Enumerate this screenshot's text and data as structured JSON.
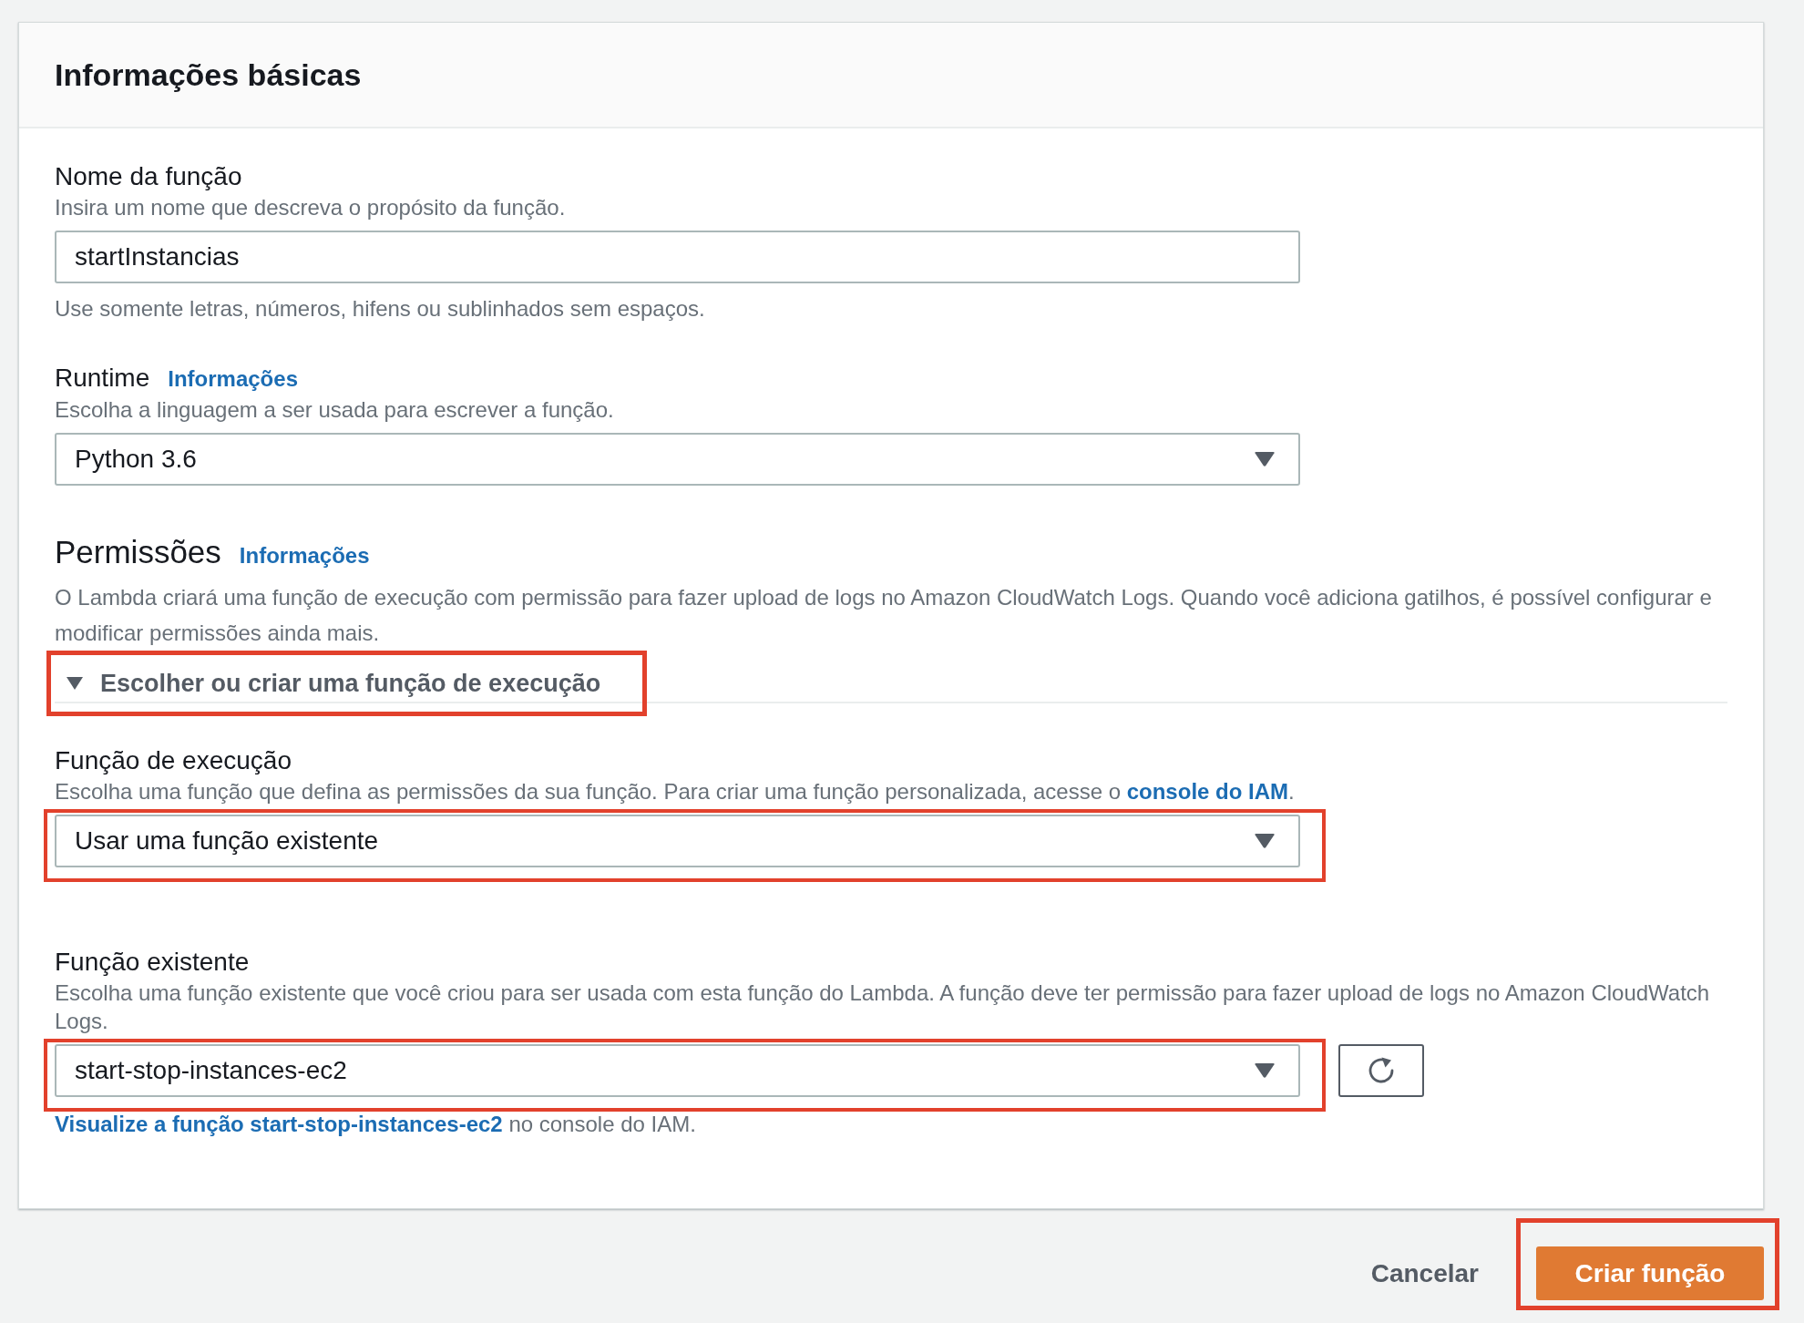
{
  "panel": {
    "title": "Informações básicas"
  },
  "fields": [
    {
      "kind": "text_input",
      "label": "Nome da função",
      "description": "Insira um nome que descreva o propósito da função.",
      "value": "startInstancias",
      "hint": "Use somente letras, números, hifens ou sublinhados sem espaços.",
      "highlighted": false
    },
    {
      "kind": "select",
      "label": "Runtime",
      "info_link": "Informações",
      "description": "Escolha a linguagem a ser usada para escrever a função.",
      "value": "Python 3.6",
      "highlighted": false
    }
  ],
  "permissions": {
    "heading": "Permissões",
    "info_link": "Informações",
    "description": "O Lambda criará uma função de execução com permissão para fazer upload de logs no Amazon CloudWatch Logs. Quando você adiciona gatilhos, é possível configurar e modificar permissões ainda mais.",
    "expander": {
      "label": "Escolher ou criar uma função de execução",
      "expanded": true,
      "highlighted": true
    },
    "fields": [
      {
        "kind": "select",
        "label": "Função de execução",
        "description_parts": [
          {
            "kind": "text",
            "text": "Escolha uma função que defina as permissões da sua função. Para criar uma função personalizada, acesse o "
          },
          {
            "kind": "link",
            "text": "console do IAM"
          },
          {
            "kind": "text",
            "text": "."
          }
        ],
        "value": "Usar uma função existente",
        "highlighted": true
      },
      {
        "kind": "select_with_refresh",
        "label": "Função existente",
        "description": "Escolha uma função existente que você criou para ser usada com esta função do Lambda. A função deve ter permissão para fazer upload de logs no Amazon CloudWatch Logs.",
        "value": "start-stop-instances-ec2",
        "highlighted": true,
        "help_parts": [
          {
            "kind": "link",
            "text": "Visualize a função start-stop-instances-ec2"
          },
          {
            "kind": "text",
            "text": " no console do IAM."
          }
        ]
      }
    ]
  },
  "footer": {
    "buttons": [
      {
        "kind": "link",
        "label": "Cancelar",
        "highlighted": false
      },
      {
        "kind": "primary",
        "label": "Criar função",
        "highlighted": true
      }
    ]
  }
}
